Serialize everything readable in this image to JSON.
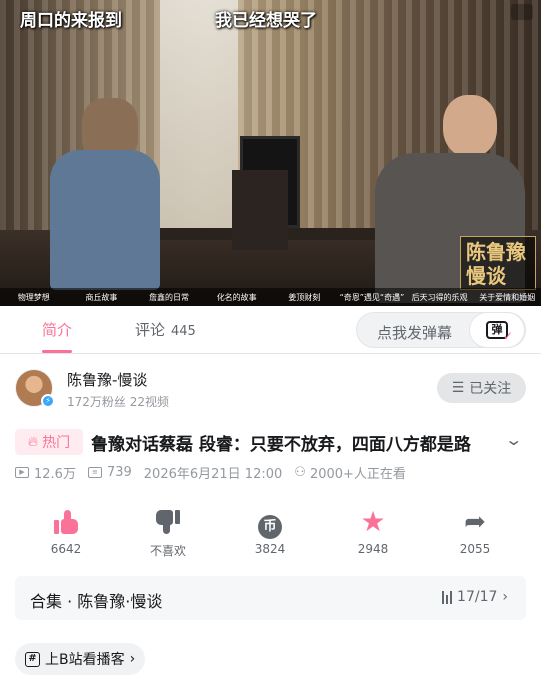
{
  "video": {
    "subtitle_left": "周口的来报到",
    "subtitle_right": "我已经想哭了",
    "logo_text": "陈鲁豫慢谈",
    "chapters": [
      "物理梦想",
      "商丘故事",
      "詹鑫的日常",
      "化名的故事",
      "姜顶财刻",
      "“奇恩”遇见“奇遇”",
      "后天习得的乐观",
      "关于爱情和婚姻"
    ]
  },
  "tabs": {
    "intro_label": "简介",
    "comments_label": "评论",
    "comments_count": "445"
  },
  "danmu": {
    "placeholder": "点我发弹幕",
    "button_glyph": "弹"
  },
  "uploader": {
    "name": "陈鲁豫-慢谈",
    "stats": "172万粉丝  22视频",
    "follow_label": "已关注"
  },
  "video_info": {
    "hot_label": "热门",
    "title": "鲁豫对话蔡磊 段睿：只要不放弃，四面八方都是路",
    "views": "12.6万",
    "danmaku": "739",
    "datetime": "2026年6月21日 12:00",
    "watching": "2000+人正在看"
  },
  "actions": {
    "like": "6642",
    "dislike": "不喜欢",
    "coin": "3824",
    "favorite": "2948",
    "share": "2055"
  },
  "collection": {
    "title": "合集 · 陈鲁豫·慢谈",
    "progress": "17/17"
  },
  "tag": {
    "label": "上B站看播客"
  },
  "colors": {
    "accent": "#fb7299",
    "text": "#18191c",
    "secondary": "#9499a0"
  }
}
